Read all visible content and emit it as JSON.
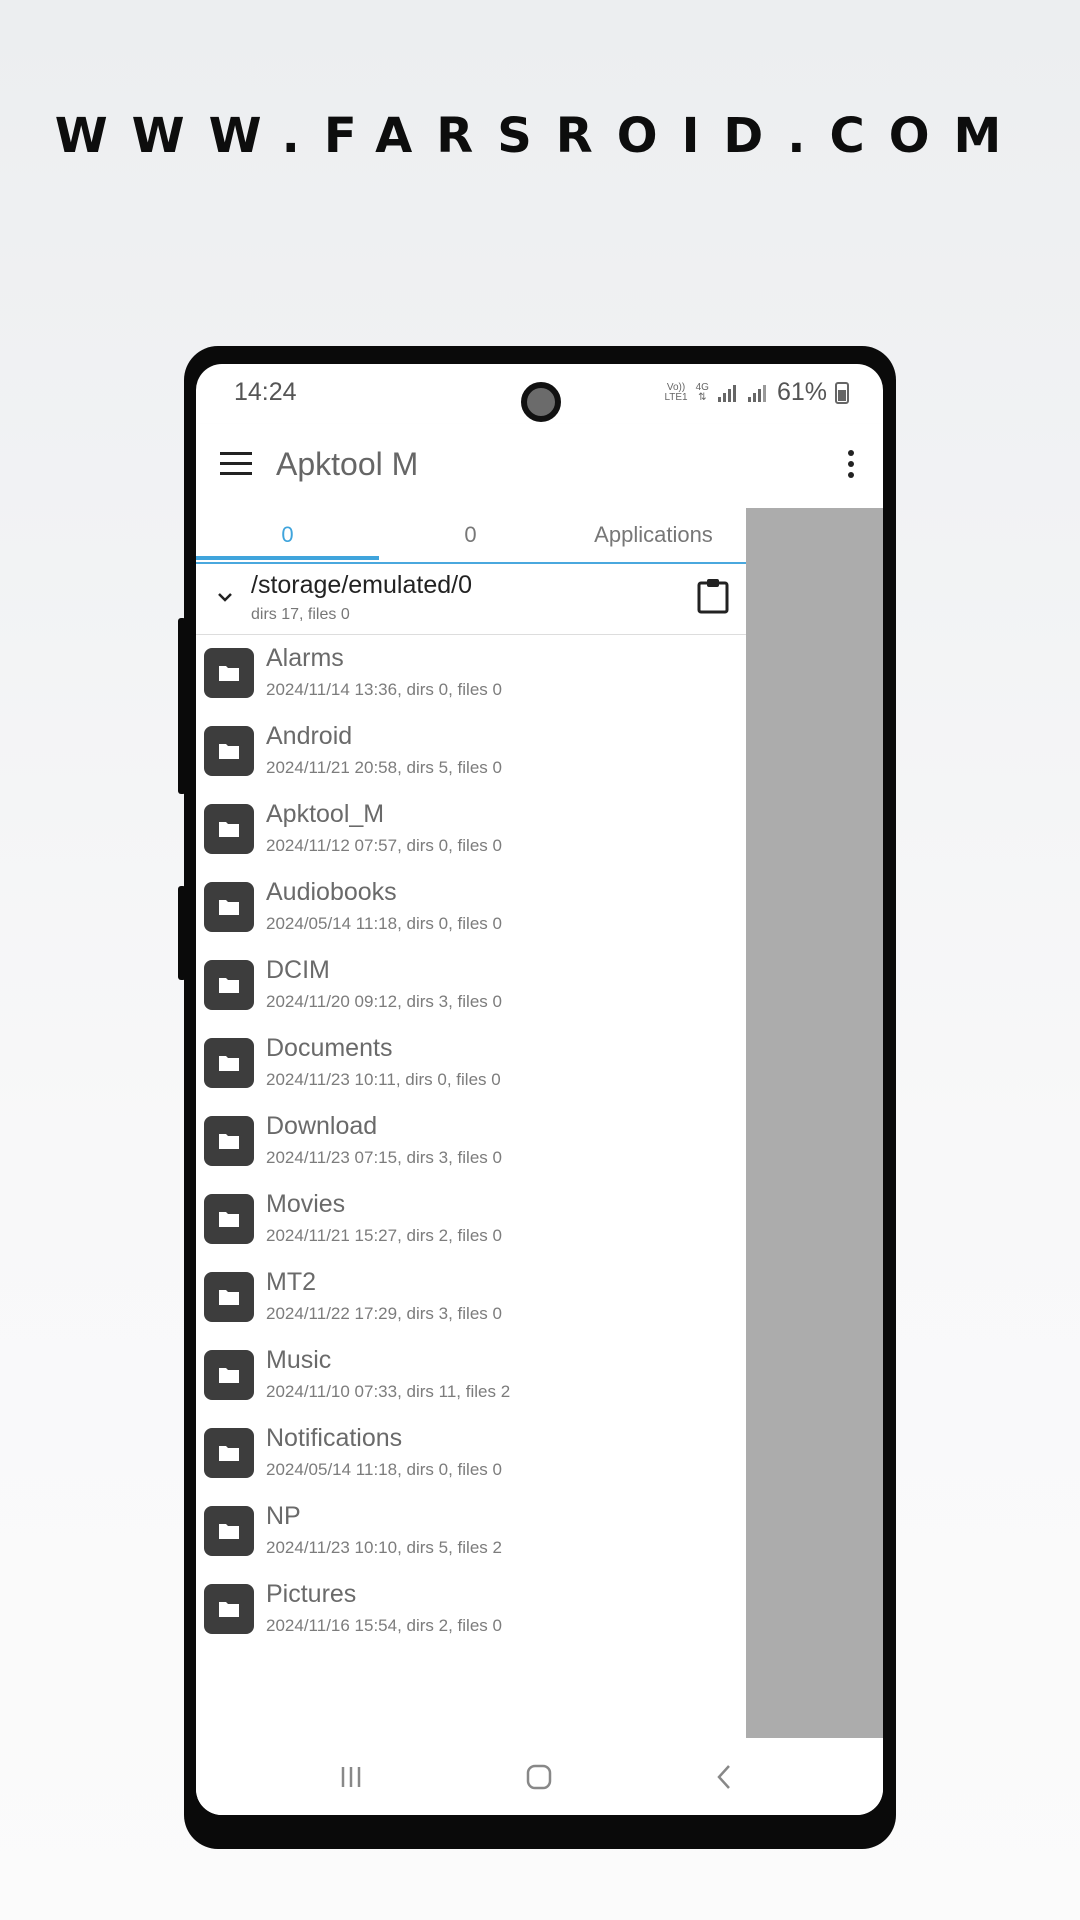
{
  "banner": {
    "text": "WWW.FARSROID.COM"
  },
  "status_bar": {
    "time": "14:24",
    "network_line1": "Vo))",
    "network_line2": "LTE1",
    "network_type": "4G",
    "battery_percent": "61%"
  },
  "app_bar": {
    "title": "Apktool M"
  },
  "tabs": [
    {
      "label": "0",
      "active": true
    },
    {
      "label": "0",
      "active": false
    },
    {
      "label": "Applications",
      "active": false
    }
  ],
  "path": {
    "current": "/storage/emulated/0",
    "summary": "dirs 17, files 0"
  },
  "folders": [
    {
      "name": "Alarms",
      "meta": "2024/11/14 13:36, dirs 0, files 0"
    },
    {
      "name": "Android",
      "meta": "2024/11/21 20:58, dirs 5, files 0"
    },
    {
      "name": "Apktool_M",
      "meta": "2024/11/12 07:57, dirs 0, files 0"
    },
    {
      "name": "Audiobooks",
      "meta": "2024/05/14 11:18, dirs 0, files 0"
    },
    {
      "name": "DCIM",
      "meta": "2024/11/20 09:12, dirs 3, files 0"
    },
    {
      "name": "Documents",
      "meta": "2024/11/23 10:11, dirs 0, files 0"
    },
    {
      "name": "Download",
      "meta": "2024/11/23 07:15, dirs 3, files 0"
    },
    {
      "name": "Movies",
      "meta": "2024/11/21 15:27, dirs 2, files 0"
    },
    {
      "name": "MT2",
      "meta": "2024/11/22 17:29, dirs 3, files 0"
    },
    {
      "name": "Music",
      "meta": "2024/11/10 07:33, dirs 11, files 2"
    },
    {
      "name": "Notifications",
      "meta": "2024/05/14 11:18, dirs 0, files 0"
    },
    {
      "name": "NP",
      "meta": "2024/11/23 10:10, dirs 5, files 2"
    },
    {
      "name": "Pictures",
      "meta": "2024/11/16 15:54, dirs 2, files 0"
    }
  ],
  "bottom_bar": [
    "bookmark-icon",
    "search-icon",
    "add-icon",
    "swap-icon",
    "arrow-up-icon"
  ],
  "nav_bar": [
    "recents-icon",
    "home-icon",
    "back-icon"
  ]
}
